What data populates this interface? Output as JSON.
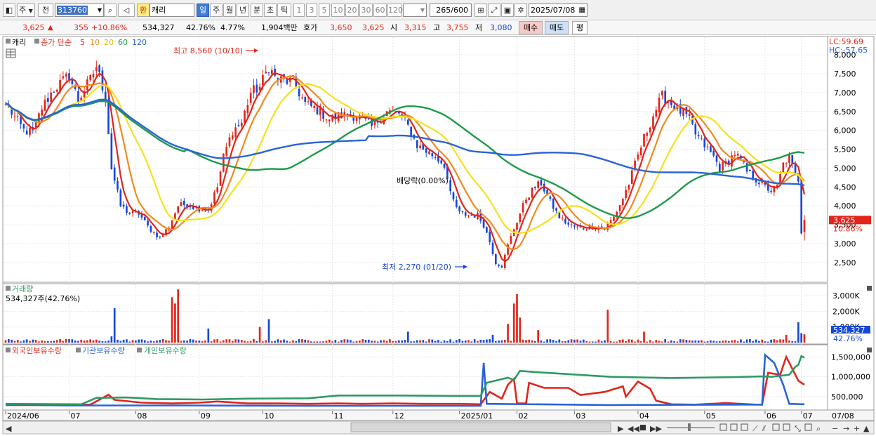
{
  "toolbar": {
    "market": "주",
    "jeon": "전",
    "code": "313760",
    "name": "캐리",
    "hwan": "환",
    "periods": [
      "일",
      "주",
      "월",
      "년",
      "분",
      "초",
      "틱"
    ],
    "active_period": "일",
    "intervals": [
      "1",
      "3",
      "5",
      "10",
      "20",
      "30",
      "60",
      "120"
    ],
    "count": "265",
    "count_total": "/600",
    "date": "2025/07/08"
  },
  "quote": {
    "price": "3,625",
    "change_arrow": "▲",
    "change": "355",
    "change_pct": "+10.86%",
    "volume": "534,327",
    "volume_ratio": "42.76%",
    "turnover_rate": "4.77%",
    "amount": "1,904백만",
    "hoga_label": "호가",
    "ask": "3,650",
    "bid": "3,625",
    "open_label": "시",
    "open": "3,315",
    "high_label": "고",
    "high": "3,755",
    "low_label": "저",
    "low": "3,080",
    "buy_button": "매수",
    "sell_button": "매도",
    "eval_button": "평"
  },
  "colors": {
    "up": "#e1251b",
    "down": "#1747d8",
    "ma5": "#e1251b",
    "ma10": "#f08a1e",
    "ma20": "#f4e21b",
    "ma60": "#209a48",
    "ma120": "#2b63d8",
    "foreign": "#e1251b",
    "institution": "#2b63d8",
    "individual": "#2f9a64",
    "current_price_box": "#e1251b",
    "volume_box": "#1747d8"
  },
  "legend": {
    "stock_name": "캐리",
    "ma_label": "종가 단순",
    "ma_periods": [
      "5",
      "10",
      "20",
      "60",
      "120"
    ]
  },
  "annotations": {
    "high": "최고 8,560 (10/10)",
    "low": "최저 2,270 (01/20)",
    "dividend": "배당락(0.00%)",
    "lc": "LC:59.69",
    "hc": "HC:-57.65",
    "current_price": "3,625",
    "current_pct": "10.86%",
    "volume_title": "거래량",
    "volume_value": "534,327주(42.76%)",
    "current_volume": "534,327",
    "current_volume_pct": "42.76%",
    "holding_series": [
      "외국인보유수량",
      "기관보유수량",
      "개인보유수량"
    ]
  },
  "x_axis": {
    "labels": [
      "2024/06",
      "07",
      "08",
      "09",
      "10",
      "11",
      "12",
      "2025/01",
      "02",
      "03",
      "04",
      "05",
      "06",
      "07"
    ],
    "right_label": "07/08"
  },
  "chart_data": [
    {
      "type": "candlestick",
      "title": "캐리",
      "x_range": [
        "2024/06",
        "2025/07/08"
      ],
      "ylim": [
        2200,
        8300
      ],
      "y_ticks": [
        2500,
        3000,
        3500,
        4000,
        4500,
        5000,
        5500,
        6000,
        6500,
        7000,
        7500,
        8000
      ],
      "y_tick_labels": [
        "2,500",
        "3,000",
        "3,500",
        "4,000",
        "4,500",
        "5,000",
        "5,500",
        "6,000",
        "6,500",
        "7,000",
        "7,500",
        "8,000"
      ],
      "bars": 265,
      "close_anchors": [
        {
          "i": 0,
          "v": 6700
        },
        {
          "i": 6,
          "v": 6000
        },
        {
          "i": 9,
          "v": 5950
        },
        {
          "i": 12,
          "v": 6600
        },
        {
          "i": 16,
          "v": 7100
        },
        {
          "i": 21,
          "v": 7450
        },
        {
          "i": 24,
          "v": 6800
        },
        {
          "i": 28,
          "v": 7350
        },
        {
          "i": 30,
          "v": 7700
        },
        {
          "i": 33,
          "v": 6900
        },
        {
          "i": 35,
          "v": 5000
        },
        {
          "i": 38,
          "v": 4000
        },
        {
          "i": 41,
          "v": 3800
        },
        {
          "i": 44,
          "v": 3800
        },
        {
          "i": 47,
          "v": 3450
        },
        {
          "i": 51,
          "v": 3150
        },
        {
          "i": 54,
          "v": 3450
        },
        {
          "i": 57,
          "v": 4000
        },
        {
          "i": 60,
          "v": 4050
        },
        {
          "i": 63,
          "v": 3950
        },
        {
          "i": 67,
          "v": 3900
        },
        {
          "i": 70,
          "v": 4500
        },
        {
          "i": 72,
          "v": 5300
        },
        {
          "i": 75,
          "v": 6000
        },
        {
          "i": 78,
          "v": 6200
        },
        {
          "i": 81,
          "v": 7000
        },
        {
          "i": 84,
          "v": 7150
        },
        {
          "i": 87,
          "v": 7700
        },
        {
          "i": 89,
          "v": 7400
        },
        {
          "i": 92,
          "v": 7300
        },
        {
          "i": 95,
          "v": 7300
        },
        {
          "i": 99,
          "v": 6700
        },
        {
          "i": 103,
          "v": 6550
        },
        {
          "i": 107,
          "v": 6300
        },
        {
          "i": 111,
          "v": 6400
        },
        {
          "i": 116,
          "v": 6400
        },
        {
          "i": 121,
          "v": 6100
        },
        {
          "i": 126,
          "v": 6500
        },
        {
          "i": 130,
          "v": 6450
        },
        {
          "i": 133,
          "v": 6100
        },
        {
          "i": 136,
          "v": 5600
        },
        {
          "i": 139,
          "v": 5450
        },
        {
          "i": 142,
          "v": 5300
        },
        {
          "i": 145,
          "v": 5100
        },
        {
          "i": 147,
          "v": 4300
        },
        {
          "i": 150,
          "v": 3800
        },
        {
          "i": 153,
          "v": 3750
        },
        {
          "i": 156,
          "v": 3750
        },
        {
          "i": 158,
          "v": 3500
        },
        {
          "i": 160,
          "v": 3050
        },
        {
          "i": 162,
          "v": 2500
        },
        {
          "i": 164,
          "v": 2400
        },
        {
          "i": 166,
          "v": 2950
        },
        {
          "i": 168,
          "v": 3400
        },
        {
          "i": 170,
          "v": 3800
        },
        {
          "i": 172,
          "v": 4200
        },
        {
          "i": 175,
          "v": 4500
        },
        {
          "i": 177,
          "v": 4600
        },
        {
          "i": 180,
          "v": 4100
        },
        {
          "i": 183,
          "v": 3700
        },
        {
          "i": 186,
          "v": 3500
        },
        {
          "i": 190,
          "v": 3400
        },
        {
          "i": 194,
          "v": 3450
        },
        {
          "i": 198,
          "v": 3400
        },
        {
          "i": 201,
          "v": 3700
        },
        {
          "i": 204,
          "v": 4200
        },
        {
          "i": 206,
          "v": 4600
        },
        {
          "i": 208,
          "v": 5100
        },
        {
          "i": 211,
          "v": 5800
        },
        {
          "i": 214,
          "v": 6400
        },
        {
          "i": 217,
          "v": 6900
        },
        {
          "i": 220,
          "v": 6700
        },
        {
          "i": 223,
          "v": 6500
        },
        {
          "i": 226,
          "v": 6300
        },
        {
          "i": 228,
          "v": 5900
        },
        {
          "i": 231,
          "v": 5600
        },
        {
          "i": 234,
          "v": 5300
        },
        {
          "i": 236,
          "v": 5000
        },
        {
          "i": 239,
          "v": 5200
        },
        {
          "i": 241,
          "v": 5400
        },
        {
          "i": 243,
          "v": 5200
        },
        {
          "i": 245,
          "v": 4900
        },
        {
          "i": 248,
          "v": 4700
        },
        {
          "i": 251,
          "v": 4500
        },
        {
          "i": 253,
          "v": 4400
        },
        {
          "i": 255,
          "v": 4500
        },
        {
          "i": 257,
          "v": 5100
        },
        {
          "i": 259,
          "v": 5300
        },
        {
          "i": 261,
          "v": 4800
        },
        {
          "i": 262,
          "v": 4700
        },
        {
          "i": 263,
          "v": 3270
        },
        {
          "i": 264,
          "v": 3625
        }
      ],
      "moving_averages": [
        {
          "name": "5",
          "color": "#e1251b"
        },
        {
          "name": "10",
          "color": "#f08a1e"
        },
        {
          "name": "20",
          "color": "#f4e21b"
        },
        {
          "name": "60",
          "color": "#209a48"
        },
        {
          "name": "120",
          "color": "#2b63d8"
        }
      ]
    },
    {
      "type": "bar",
      "title": "거래량",
      "y_ticks": [
        1000000,
        2000000,
        3000000
      ],
      "y_tick_labels": [
        "1,000K",
        "2,000K",
        "3,000K"
      ],
      "ylim": [
        0,
        3500000
      ],
      "spikes": [
        {
          "i": 35,
          "v": 400000
        },
        {
          "i": 36,
          "v": 2200000
        },
        {
          "i": 55,
          "v": 2900000
        },
        {
          "i": 56,
          "v": 2500000
        },
        {
          "i": 57,
          "v": 3400000
        },
        {
          "i": 67,
          "v": 900000
        },
        {
          "i": 84,
          "v": 1000000
        },
        {
          "i": 87,
          "v": 1500000
        },
        {
          "i": 133,
          "v": 700000
        },
        {
          "i": 161,
          "v": 500000
        },
        {
          "i": 166,
          "v": 1200000
        },
        {
          "i": 168,
          "v": 2500000
        },
        {
          "i": 169,
          "v": 3100000
        },
        {
          "i": 170,
          "v": 1600000
        },
        {
          "i": 176,
          "v": 800000
        },
        {
          "i": 199,
          "v": 2100000
        },
        {
          "i": 211,
          "v": 700000
        },
        {
          "i": 258,
          "v": 500000
        },
        {
          "i": 262,
          "v": 1300000
        },
        {
          "i": 263,
          "v": 600000
        },
        {
          "i": 264,
          "v": 534327
        }
      ]
    },
    {
      "type": "line",
      "title": "보유수량",
      "y_ticks": [
        500000,
        1000000,
        1500000
      ],
      "y_tick_labels": [
        "500,000",
        "1,000,000",
        "1,500,000"
      ],
      "ylim": [
        200000,
        1700000
      ],
      "series": [
        {
          "name": "외국인보유수량",
          "color": "#e1251b",
          "points": [
            [
              0,
              290000
            ],
            [
              10,
              290000
            ],
            [
              28,
              300000
            ],
            [
              34,
              550000
            ],
            [
              36,
              420000
            ],
            [
              45,
              350000
            ],
            [
              55,
              330000
            ],
            [
              64,
              350000
            ],
            [
              70,
              380000
            ],
            [
              80,
              330000
            ],
            [
              90,
              330000
            ],
            [
              100,
              320000
            ],
            [
              110,
              330000
            ],
            [
              118,
              320000
            ],
            [
              128,
              330000
            ],
            [
              138,
              320000
            ],
            [
              150,
              320000
            ],
            [
              157,
              310000
            ],
            [
              160,
              620000
            ],
            [
              164,
              450000
            ],
            [
              166,
              800000
            ],
            [
              168,
              950000
            ],
            [
              169,
              330000
            ],
            [
              172,
              330000
            ],
            [
              173,
              850000
            ],
            [
              178,
              720000
            ],
            [
              186,
              720000
            ],
            [
              190,
              540000
            ],
            [
              198,
              620000
            ],
            [
              204,
              760000
            ],
            [
              205,
              500000
            ],
            [
              209,
              880000
            ],
            [
              213,
              700000
            ],
            [
              215,
              400000
            ],
            [
              220,
              310000
            ],
            [
              228,
              300000
            ],
            [
              238,
              340000
            ],
            [
              248,
              300000
            ],
            [
              250,
              300000
            ],
            [
              252,
              1100000
            ],
            [
              256,
              1050000
            ],
            [
              258,
              1500000
            ],
            [
              260,
              1200000
            ],
            [
              262,
              900000
            ],
            [
              264,
              800000
            ]
          ]
        },
        {
          "name": "기관보유수량",
          "color": "#2b63d8",
          "points": [
            [
              0,
              300000
            ],
            [
              20,
              280000
            ],
            [
              60,
              280000
            ],
            [
              100,
              270000
            ],
            [
              150,
              270000
            ],
            [
              157,
              270000
            ],
            [
              158,
              1350000
            ],
            [
              159,
              320000
            ],
            [
              200,
              290000
            ],
            [
              245,
              300000
            ],
            [
              250,
              300000
            ],
            [
              251,
              1550000
            ],
            [
              254,
              1350000
            ],
            [
              257,
              800000
            ],
            [
              259,
              320000
            ],
            [
              264,
              310000
            ]
          ]
        },
        {
          "name": "개인보유수량",
          "color": "#2f9a64",
          "points": [
            [
              0,
              320000
            ],
            [
              25,
              310000
            ],
            [
              30,
              470000
            ],
            [
              40,
              480000
            ],
            [
              50,
              440000
            ],
            [
              65,
              430000
            ],
            [
              80,
              450000
            ],
            [
              100,
              460000
            ],
            [
              110,
              530000
            ],
            [
              130,
              530000
            ],
            [
              150,
              520000
            ],
            [
              157,
              520000
            ],
            [
              159,
              850000
            ],
            [
              166,
              980000
            ],
            [
              168,
              920000
            ],
            [
              170,
              1150000
            ],
            [
              175,
              1120000
            ],
            [
              200,
              1000000
            ],
            [
              220,
              970000
            ],
            [
              240,
              990000
            ],
            [
              250,
              1010000
            ],
            [
              253,
              1000000
            ],
            [
              259,
              1050000
            ],
            [
              261,
              1250000
            ],
            [
              262,
              1300000
            ],
            [
              263,
              1520000
            ],
            [
              264,
              1480000
            ]
          ]
        }
      ]
    }
  ]
}
